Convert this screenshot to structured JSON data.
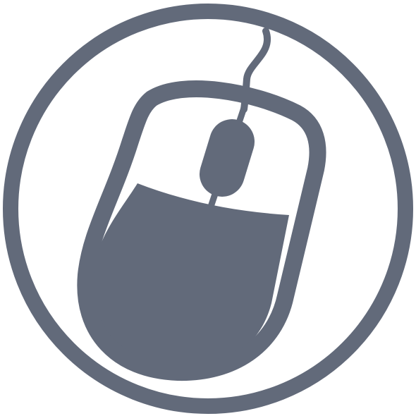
{
  "icon": {
    "name": "computer-mouse-icon",
    "color": "#626a7a",
    "background": "#ffffff"
  }
}
